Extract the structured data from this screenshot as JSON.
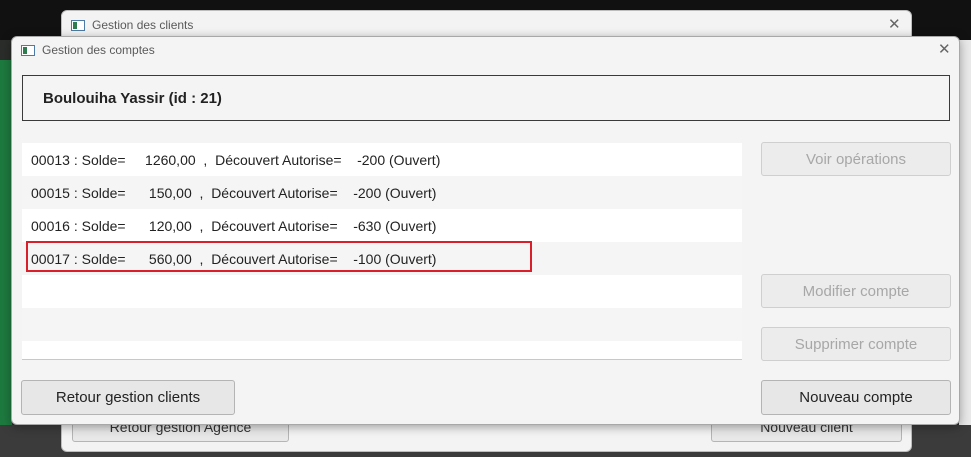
{
  "back_window": {
    "title": "Gestion des clients",
    "button_left": "Retour gestion Agence",
    "button_right": "Nouveau client"
  },
  "window": {
    "title": "Gestion des comptes",
    "client_header": "Boulouiha  Yassir  (id : 21)"
  },
  "accounts": [
    {
      "text": "00013 : Solde=     1260,00  ,  Découvert Autorise=    -200 (Ouvert)"
    },
    {
      "text": "00015 : Solde=      150,00  ,  Découvert Autorise=    -200 (Ouvert)"
    },
    {
      "text": "00016 : Solde=      120,00  ,  Découvert Autorise=    -630 (Ouvert)"
    },
    {
      "text": "00017 : Solde=      560,00  ,  Découvert Autorise=    -100 (Ouvert)"
    },
    {
      "text": ""
    },
    {
      "text": ""
    }
  ],
  "buttons": {
    "voir_operations": "Voir opérations",
    "modifier_compte": "Modifier compte",
    "supprimer_compte": "Supprimer compte",
    "retour_gestion_clients": "Retour gestion clients",
    "nouveau_compte": "Nouveau compte"
  },
  "colors": {
    "highlight": "#d9202a"
  }
}
